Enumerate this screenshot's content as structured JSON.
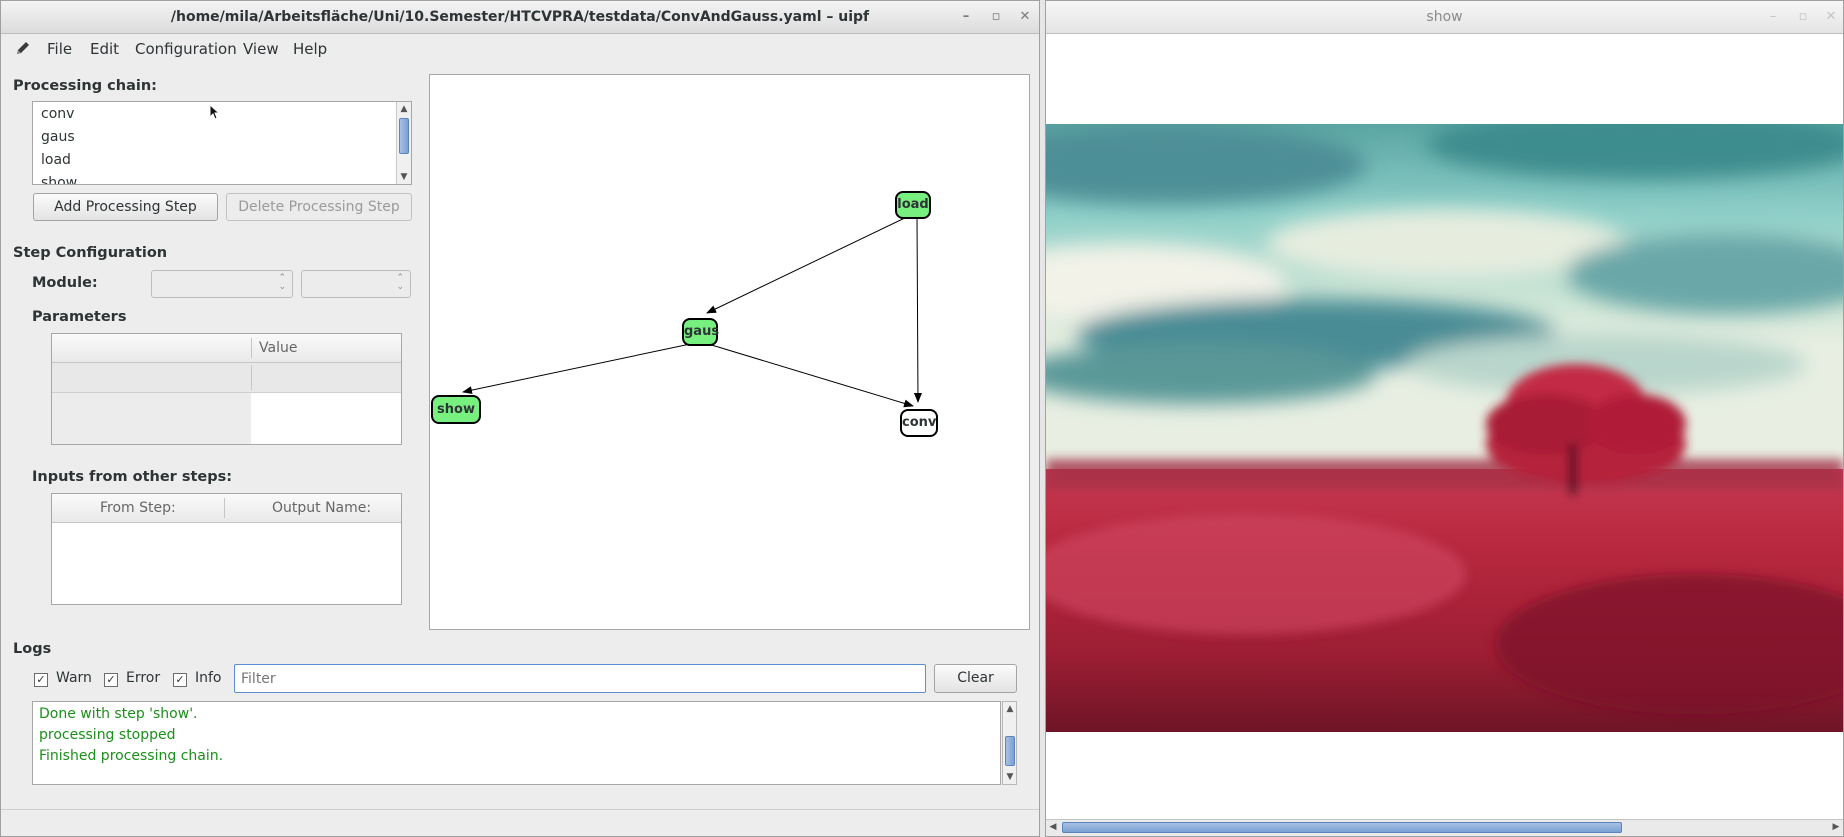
{
  "main_window": {
    "title": "/home/mila/Arbeitsfläche/Uni/10.Semester/HTCVPRA/testdata/ConvAndGauss.yaml – uipf",
    "controls": [
      "–",
      "▫",
      "✕"
    ]
  },
  "menu": {
    "app_icon": "pencil-icon",
    "items": [
      "File",
      "Edit",
      "Configuration",
      "View",
      "Help"
    ]
  },
  "processing_chain": {
    "label": "Processing chain:",
    "items": [
      "conv",
      "gaus",
      "load",
      "show"
    ],
    "add_button": "Add Processing Step",
    "delete_button": "Delete Processing Step"
  },
  "step_config": {
    "title": "Step Configuration",
    "module_label": "Module:",
    "module_value": "",
    "submodule_value": "",
    "parameters_label": "Parameters",
    "param_columns": [
      "",
      "Value"
    ],
    "inputs_label": "Inputs from other steps:",
    "input_columns": [
      "From Step:",
      "Output Name:"
    ]
  },
  "graph": {
    "nodes": [
      {
        "id": "load",
        "label": "load",
        "highlighted": true
      },
      {
        "id": "gaus",
        "label": "gaus",
        "highlighted": true
      },
      {
        "id": "show",
        "label": "show",
        "highlighted": true
      },
      {
        "id": "conv",
        "label": "conv",
        "highlighted": false
      }
    ],
    "edges": [
      {
        "from": "load",
        "to": "gaus"
      },
      {
        "from": "load",
        "to": "conv"
      },
      {
        "from": "gaus",
        "to": "show"
      },
      {
        "from": "gaus",
        "to": "conv"
      }
    ],
    "highlight_color": "#77f07f"
  },
  "logs": {
    "title": "Logs",
    "filters": [
      {
        "label": "Warn",
        "checked": true
      },
      {
        "label": "Error",
        "checked": true
      },
      {
        "label": "Info",
        "checked": true
      }
    ],
    "filter_placeholder": "Filter",
    "clear_button": "Clear",
    "lines": [
      "Done with step 'show'.",
      "processing stopped",
      "Finished processing chain."
    ],
    "line_color": "#1a8f1a"
  },
  "show_window": {
    "title": "show",
    "controls": [
      "–",
      "▫",
      "✕"
    ],
    "image_description": "blurred red wheat field with a red tree under a teal sky"
  }
}
